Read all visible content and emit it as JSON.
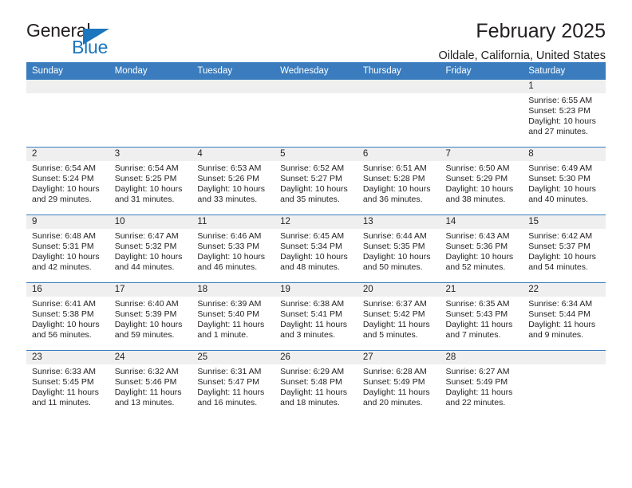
{
  "brand": {
    "name_part1": "General",
    "name_part2": "Blue",
    "accent_color": "#1b76bd"
  },
  "header": {
    "title": "February 2025",
    "subtitle": "Oildale, California, United States"
  },
  "calendar": {
    "header_bg": "#3a7cbe",
    "daynum_bg": "#efeff0",
    "weekday_headers": [
      "Sunday",
      "Monday",
      "Tuesday",
      "Wednesday",
      "Thursday",
      "Friday",
      "Saturday"
    ],
    "weeks": [
      [
        {
          "day": "",
          "sunrise": "",
          "sunset": "",
          "daylight": "",
          "empty": true
        },
        {
          "day": "",
          "sunrise": "",
          "sunset": "",
          "daylight": "",
          "empty": true
        },
        {
          "day": "",
          "sunrise": "",
          "sunset": "",
          "daylight": "",
          "empty": true
        },
        {
          "day": "",
          "sunrise": "",
          "sunset": "",
          "daylight": "",
          "empty": true
        },
        {
          "day": "",
          "sunrise": "",
          "sunset": "",
          "daylight": "",
          "empty": true
        },
        {
          "day": "",
          "sunrise": "",
          "sunset": "",
          "daylight": "",
          "empty": true
        },
        {
          "day": "1",
          "sunrise": "Sunrise: 6:55 AM",
          "sunset": "Sunset: 5:23 PM",
          "daylight": "Daylight: 10 hours and 27 minutes.",
          "empty": false
        }
      ],
      [
        {
          "day": "2",
          "sunrise": "Sunrise: 6:54 AM",
          "sunset": "Sunset: 5:24 PM",
          "daylight": "Daylight: 10 hours and 29 minutes.",
          "empty": false
        },
        {
          "day": "3",
          "sunrise": "Sunrise: 6:54 AM",
          "sunset": "Sunset: 5:25 PM",
          "daylight": "Daylight: 10 hours and 31 minutes.",
          "empty": false
        },
        {
          "day": "4",
          "sunrise": "Sunrise: 6:53 AM",
          "sunset": "Sunset: 5:26 PM",
          "daylight": "Daylight: 10 hours and 33 minutes.",
          "empty": false
        },
        {
          "day": "5",
          "sunrise": "Sunrise: 6:52 AM",
          "sunset": "Sunset: 5:27 PM",
          "daylight": "Daylight: 10 hours and 35 minutes.",
          "empty": false
        },
        {
          "day": "6",
          "sunrise": "Sunrise: 6:51 AM",
          "sunset": "Sunset: 5:28 PM",
          "daylight": "Daylight: 10 hours and 36 minutes.",
          "empty": false
        },
        {
          "day": "7",
          "sunrise": "Sunrise: 6:50 AM",
          "sunset": "Sunset: 5:29 PM",
          "daylight": "Daylight: 10 hours and 38 minutes.",
          "empty": false
        },
        {
          "day": "8",
          "sunrise": "Sunrise: 6:49 AM",
          "sunset": "Sunset: 5:30 PM",
          "daylight": "Daylight: 10 hours and 40 minutes.",
          "empty": false
        }
      ],
      [
        {
          "day": "9",
          "sunrise": "Sunrise: 6:48 AM",
          "sunset": "Sunset: 5:31 PM",
          "daylight": "Daylight: 10 hours and 42 minutes.",
          "empty": false
        },
        {
          "day": "10",
          "sunrise": "Sunrise: 6:47 AM",
          "sunset": "Sunset: 5:32 PM",
          "daylight": "Daylight: 10 hours and 44 minutes.",
          "empty": false
        },
        {
          "day": "11",
          "sunrise": "Sunrise: 6:46 AM",
          "sunset": "Sunset: 5:33 PM",
          "daylight": "Daylight: 10 hours and 46 minutes.",
          "empty": false
        },
        {
          "day": "12",
          "sunrise": "Sunrise: 6:45 AM",
          "sunset": "Sunset: 5:34 PM",
          "daylight": "Daylight: 10 hours and 48 minutes.",
          "empty": false
        },
        {
          "day": "13",
          "sunrise": "Sunrise: 6:44 AM",
          "sunset": "Sunset: 5:35 PM",
          "daylight": "Daylight: 10 hours and 50 minutes.",
          "empty": false
        },
        {
          "day": "14",
          "sunrise": "Sunrise: 6:43 AM",
          "sunset": "Sunset: 5:36 PM",
          "daylight": "Daylight: 10 hours and 52 minutes.",
          "empty": false
        },
        {
          "day": "15",
          "sunrise": "Sunrise: 6:42 AM",
          "sunset": "Sunset: 5:37 PM",
          "daylight": "Daylight: 10 hours and 54 minutes.",
          "empty": false
        }
      ],
      [
        {
          "day": "16",
          "sunrise": "Sunrise: 6:41 AM",
          "sunset": "Sunset: 5:38 PM",
          "daylight": "Daylight: 10 hours and 56 minutes.",
          "empty": false
        },
        {
          "day": "17",
          "sunrise": "Sunrise: 6:40 AM",
          "sunset": "Sunset: 5:39 PM",
          "daylight": "Daylight: 10 hours and 59 minutes.",
          "empty": false
        },
        {
          "day": "18",
          "sunrise": "Sunrise: 6:39 AM",
          "sunset": "Sunset: 5:40 PM",
          "daylight": "Daylight: 11 hours and 1 minute.",
          "empty": false
        },
        {
          "day": "19",
          "sunrise": "Sunrise: 6:38 AM",
          "sunset": "Sunset: 5:41 PM",
          "daylight": "Daylight: 11 hours and 3 minutes.",
          "empty": false
        },
        {
          "day": "20",
          "sunrise": "Sunrise: 6:37 AM",
          "sunset": "Sunset: 5:42 PM",
          "daylight": "Daylight: 11 hours and 5 minutes.",
          "empty": false
        },
        {
          "day": "21",
          "sunrise": "Sunrise: 6:35 AM",
          "sunset": "Sunset: 5:43 PM",
          "daylight": "Daylight: 11 hours and 7 minutes.",
          "empty": false
        },
        {
          "day": "22",
          "sunrise": "Sunrise: 6:34 AM",
          "sunset": "Sunset: 5:44 PM",
          "daylight": "Daylight: 11 hours and 9 minutes.",
          "empty": false
        }
      ],
      [
        {
          "day": "23",
          "sunrise": "Sunrise: 6:33 AM",
          "sunset": "Sunset: 5:45 PM",
          "daylight": "Daylight: 11 hours and 11 minutes.",
          "empty": false
        },
        {
          "day": "24",
          "sunrise": "Sunrise: 6:32 AM",
          "sunset": "Sunset: 5:46 PM",
          "daylight": "Daylight: 11 hours and 13 minutes.",
          "empty": false
        },
        {
          "day": "25",
          "sunrise": "Sunrise: 6:31 AM",
          "sunset": "Sunset: 5:47 PM",
          "daylight": "Daylight: 11 hours and 16 minutes.",
          "empty": false
        },
        {
          "day": "26",
          "sunrise": "Sunrise: 6:29 AM",
          "sunset": "Sunset: 5:48 PM",
          "daylight": "Daylight: 11 hours and 18 minutes.",
          "empty": false
        },
        {
          "day": "27",
          "sunrise": "Sunrise: 6:28 AM",
          "sunset": "Sunset: 5:49 PM",
          "daylight": "Daylight: 11 hours and 20 minutes.",
          "empty": false
        },
        {
          "day": "28",
          "sunrise": "Sunrise: 6:27 AM",
          "sunset": "Sunset: 5:49 PM",
          "daylight": "Daylight: 11 hours and 22 minutes.",
          "empty": false
        },
        {
          "day": "",
          "sunrise": "",
          "sunset": "",
          "daylight": "",
          "empty": true
        }
      ]
    ]
  }
}
